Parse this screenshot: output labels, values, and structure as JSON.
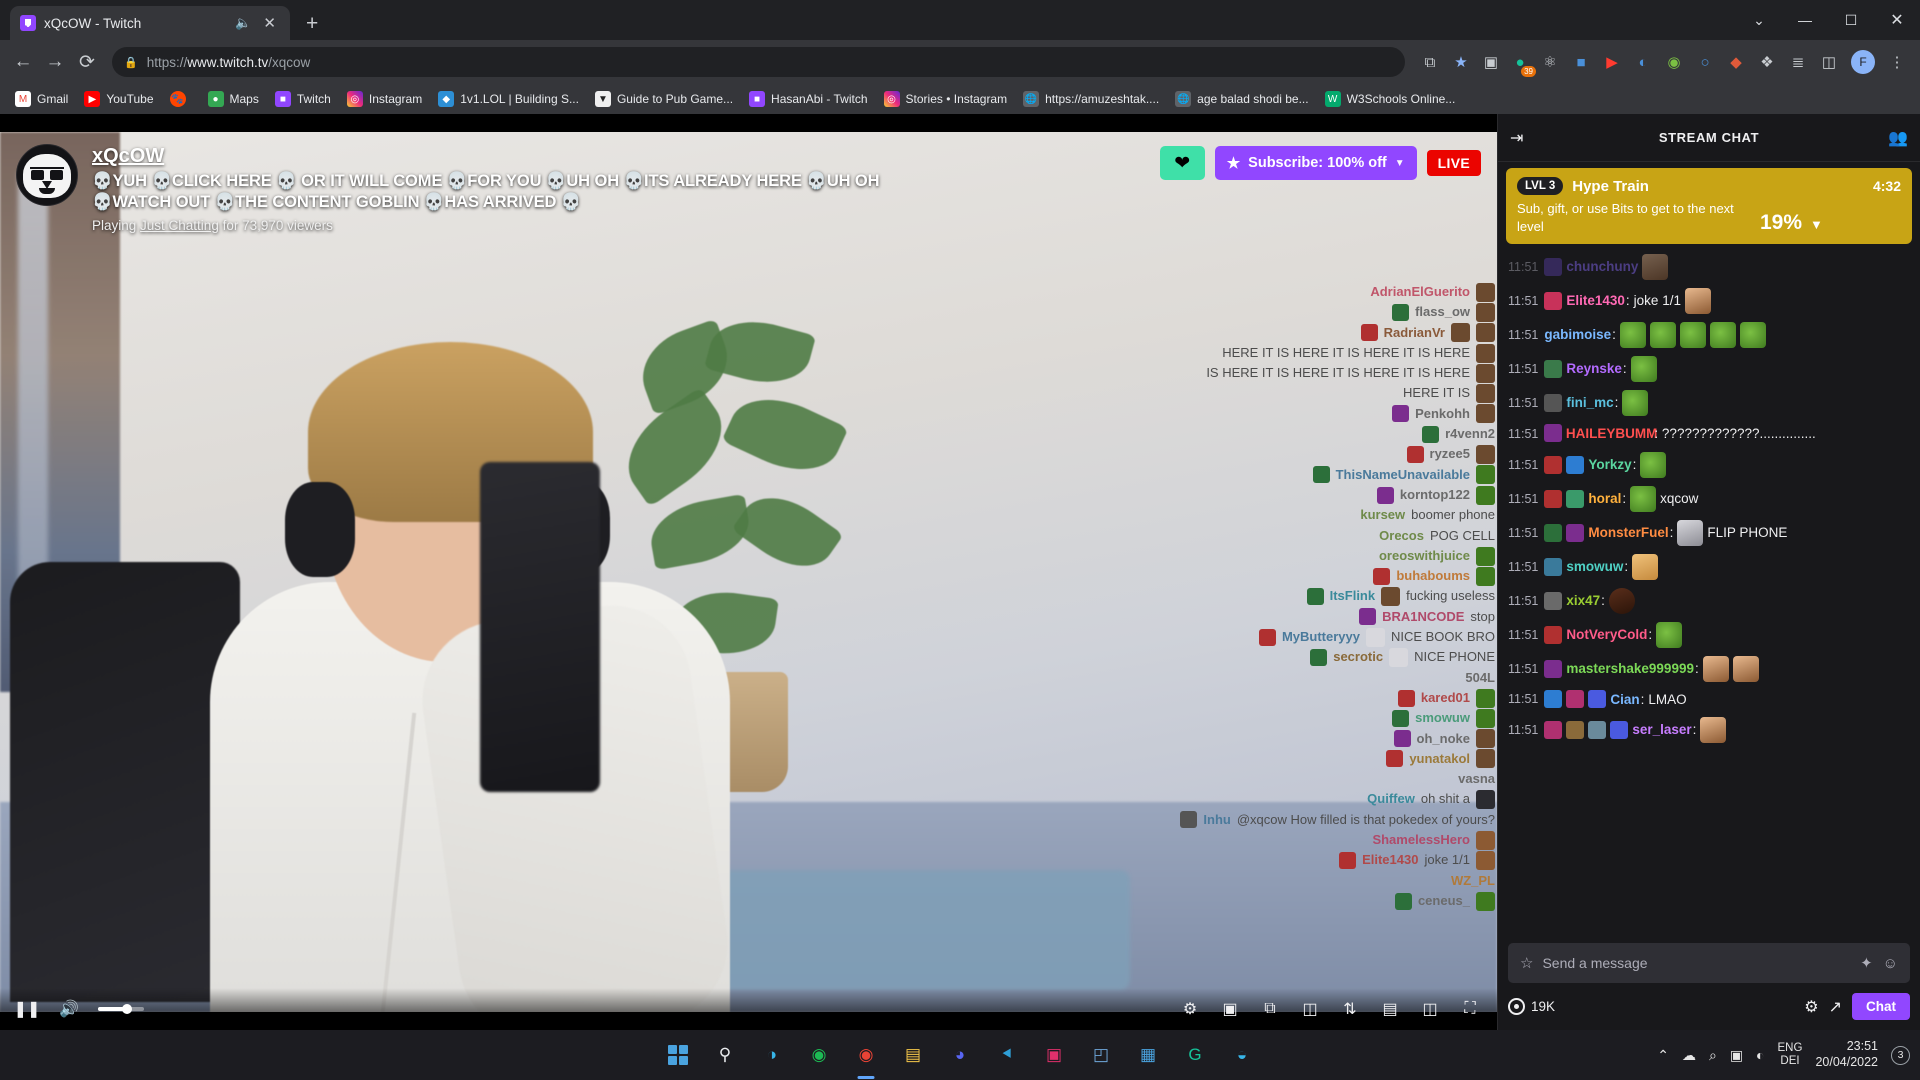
{
  "browser": {
    "tab": {
      "title": "xQcOW - Twitch",
      "favicon": "twitch-icon",
      "audio_icon": "speaker-icon",
      "close_icon": "close-icon"
    },
    "new_tab_icon": "plus-icon",
    "window_controls": {
      "minimize": "─",
      "maximize": "☐",
      "close": "✕",
      "chevron": "⌄"
    },
    "nav": {
      "back_icon": "←",
      "forward_icon": "→",
      "reload_icon": "⟳"
    },
    "omnibox": {
      "lock_icon": "lock-icon",
      "url_scheme": "https://",
      "url_host": "www.twitch.tv",
      "url_path": "/xqcow",
      "share_icon": "share-icon",
      "star_icon": "★"
    },
    "toolbar_extensions": [
      {
        "name": "extension-camera",
        "glyph": "▣",
        "badge": ""
      },
      {
        "name": "extension-grammarly",
        "glyph": "G",
        "badge": "39"
      },
      {
        "name": "extension-shield",
        "glyph": "⛉",
        "badge": ""
      },
      {
        "name": "extension-blue-square",
        "glyph": "■",
        "badge": ""
      },
      {
        "name": "extension-youtube",
        "glyph": "▶",
        "badge": ""
      },
      {
        "name": "extension-volume",
        "glyph": "◐",
        "badge": ""
      },
      {
        "name": "extension-globe",
        "glyph": "◉",
        "badge": ""
      },
      {
        "name": "extension-search",
        "glyph": "○",
        "badge": ""
      },
      {
        "name": "extension-red",
        "glyph": "◆",
        "badge": ""
      },
      {
        "name": "extension-puzzle",
        "glyph": "❖",
        "badge": ""
      },
      {
        "name": "extension-list",
        "glyph": "≣",
        "badge": ""
      },
      {
        "name": "extension-panel",
        "glyph": "◫",
        "badge": ""
      }
    ],
    "profile_initial": "F",
    "menu_icon": "⋮",
    "bookmarks": [
      {
        "label": "Gmail",
        "icon": "gmail-icon",
        "color": "#ea4335"
      },
      {
        "label": "YouTube",
        "icon": "youtube-icon",
        "color": "#ff0000"
      },
      {
        "label": "",
        "icon": "reddit-icon",
        "color": "#ff4500"
      },
      {
        "label": "Maps",
        "icon": "maps-icon",
        "color": "#34a853"
      },
      {
        "label": "Twitch",
        "icon": "twitch-icon",
        "color": "#9146ff"
      },
      {
        "label": "Instagram",
        "icon": "instagram-icon",
        "color": "#e1306c"
      },
      {
        "label": "1v1.LOL | Building S...",
        "icon": "game-icon",
        "color": "#2d8fd5"
      },
      {
        "label": "Guide to Pub Game...",
        "icon": "pub-icon",
        "color": "#efefef"
      },
      {
        "label": "HasanAbi - Twitch",
        "icon": "twitch-icon",
        "color": "#9146ff"
      },
      {
        "label": "Stories • Instagram",
        "icon": "instagram-icon",
        "color": "#e1306c"
      },
      {
        "label": "https://amuzeshtak....",
        "icon": "globe-icon",
        "color": "#5f6368"
      },
      {
        "label": "age balad shodi be...",
        "icon": "globe-icon",
        "color": "#5f6368"
      },
      {
        "label": "W3Schools Online...",
        "icon": "w3schools-icon",
        "color": "#04aa6d"
      }
    ]
  },
  "stream": {
    "channel_name": "xQcOW",
    "title": "💀YUH 💀CLICK HERE 💀 OR IT WILL COME 💀FOR YOU 💀UH OH 💀ITS ALREADY HERE 💀UH OH 💀WATCH OUT 💀THE CONTENT GOBLIN 💀HAS ARRIVED 💀",
    "playing_prefix": "Playing ",
    "category": "Just Chatting",
    "viewers_suffix": " for 73,970 viewers",
    "heart_icon": "heart-icon",
    "subscribe_label": "Subscribe: 100% off",
    "subscribe_star_icon": "star-icon",
    "subscribe_caret_icon": "chevron-down-icon",
    "live_label": "LIVE",
    "controls": {
      "pause_icon": "pause-icon",
      "volume_icon": "volume-icon",
      "settings_icon": "gear-icon",
      "theatre_icon": "theatre-icon",
      "popout_icon": "popout-icon",
      "clips_icon": "clips-icon",
      "share_icon": "share-icon",
      "picture_icon": "picture-in-picture-icon",
      "split_icon": "split-icon",
      "fullscreen_icon": "fullscreen-icon"
    }
  },
  "video_overlay_chat": [
    {
      "user": "AdrianElGuerito",
      "message": "",
      "emotes": 1
    },
    {
      "user": "flass_ow",
      "message": "",
      "emotes": 1
    },
    {
      "user": "RadrianVr",
      "message": "",
      "emotes": 2
    },
    {
      "user": "HERE IT IS HERE IT IS HERE IT IS HERE",
      "message": "",
      "emotes": 4
    },
    {
      "user": "IS HERE IT IS HERE IT IS HERE IT IS HERE",
      "message": "",
      "emotes": 4
    },
    {
      "user": "HERE IT IS",
      "message": "",
      "emotes": 1
    },
    {
      "user": "Penkohh",
      "message": "",
      "emotes": 1
    },
    {
      "user": "r4venn2",
      "message": "",
      "emotes": 0
    },
    {
      "user": "ryzee5",
      "message": "",
      "emotes": 1
    },
    {
      "user": "ThisNameUnavailable",
      "message": "",
      "emotes": 1
    },
    {
      "user": "korntop122",
      "message": "",
      "emotes": 1
    },
    {
      "user": "kursew",
      "message": "boomer phone",
      "emotes": 0
    },
    {
      "user": "Orecos",
      "message": "POG CELL",
      "emotes": 0
    },
    {
      "user": "oreoswithjuice",
      "message": "",
      "emotes": 1
    },
    {
      "user": "buhaboums",
      "message": "",
      "emotes": 1
    },
    {
      "user": "ItsFlink",
      "message": "fucking useless",
      "emotes": 1
    },
    {
      "user": "BRA1NCODE",
      "message": "stop",
      "emotes": 0
    },
    {
      "user": "MyButteryyy",
      "message": "NICE BOOK BRO",
      "emotes": 1
    },
    {
      "user": "secrotic",
      "message": "NICE PHONE",
      "emotes": 1
    },
    {
      "user": "504L",
      "message": "",
      "emotes": 0
    },
    {
      "user": "kared01",
      "message": "",
      "emotes": 1
    },
    {
      "user": "smowuw",
      "message": "",
      "emotes": 1
    },
    {
      "user": "oh_noke",
      "message": "",
      "emotes": 1
    },
    {
      "user": "yunatakol",
      "message": "",
      "emotes": 1
    },
    {
      "user": "vasna",
      "message": "",
      "emotes": 0
    },
    {
      "user": "Quiffew",
      "message": "oh shit a",
      "emotes": 1
    },
    {
      "user": "Inhu",
      "message": "@xqcow How filled is that pokedex of yours?",
      "emotes": 0
    },
    {
      "user": "ShamelessHero",
      "message": "",
      "emotes": 1
    },
    {
      "user": "Elite1430",
      "message": "joke 1/1",
      "emotes": 1
    },
    {
      "user": "WZ_PL",
      "message": "",
      "emotes": 0
    },
    {
      "user": "ceneus_",
      "message": "",
      "emotes": 1
    }
  ],
  "chat": {
    "header_title": "STREAM CHAT",
    "collapse_icon": "collapse-chat-icon",
    "community_icon": "community-icon",
    "hype_train": {
      "level_label": "LVL 3",
      "title": "Hype Train",
      "time": "4:32",
      "description": "Sub, gift, or use Bits to get to the next level",
      "percent": "19%",
      "caret_icon": "chevron-down-icon",
      "color": "#c8a415"
    },
    "messages": [
      {
        "time": "11:51",
        "user": "chunchuny",
        "color": "#8a6aff",
        "badges": 1,
        "text": "",
        "emotes": [
          "face"
        ]
      },
      {
        "time": "11:51",
        "user": "Elite1430",
        "color": "#ff69b4",
        "badges": 1,
        "text": "joke 1/1",
        "emotes": [
          "face"
        ]
      },
      {
        "time": "11:51",
        "user": "gabimoise",
        "color": "#7ab8ff",
        "badges": 0,
        "text": "",
        "emotes": [
          "pepe",
          "pepe",
          "pepe",
          "pepe",
          "pepe"
        ]
      },
      {
        "time": "11:51",
        "user": "Reynske",
        "color": "#b36bff",
        "badges": 1,
        "text": "",
        "emotes": [
          "pepe"
        ]
      },
      {
        "time": "11:51",
        "user": "fini_mc",
        "color": "#5bc0de",
        "badges": 1,
        "text": "",
        "emotes": [
          "pepe"
        ]
      },
      {
        "time": "11:51",
        "user": "HAILEYBUMM",
        "color": "#ff4f4f",
        "badges": 1,
        "text": "?????????????...............",
        "emotes": []
      },
      {
        "time": "11:51",
        "user": "Yorkzy",
        "color": "#5bd6a0",
        "badges": 2,
        "text": "",
        "emotes": [
          "pepe"
        ]
      },
      {
        "time": "11:51",
        "user": "horal",
        "color": "#ffb13d",
        "badges": 2,
        "text": "xqcow",
        "emotes": [
          "pepe"
        ]
      },
      {
        "time": "11:51",
        "user": "MonsterFuel",
        "color": "#ff8c42",
        "badges": 2,
        "text": "FLIP PHONE",
        "emotes": [
          "phone"
        ]
      },
      {
        "time": "11:51",
        "user": "smowuw",
        "color": "#4fd1c5",
        "badges": 1,
        "text": "",
        "emotes": [
          "hand"
        ]
      },
      {
        "time": "11:51",
        "user": "xix47",
        "color": "#9acd32",
        "badges": 1,
        "text": "",
        "emotes": [
          "dark"
        ]
      },
      {
        "time": "11:51",
        "user": "NotVeryCold",
        "color": "#ff5c8a",
        "badges": 1,
        "text": "",
        "emotes": [
          "pepe"
        ]
      },
      {
        "time": "11:51",
        "user": "mastershake999999",
        "color": "#7cd957",
        "badges": 1,
        "text": "",
        "emotes": [
          "face",
          "face"
        ]
      },
      {
        "time": "11:51",
        "user": "Cian",
        "color": "#7ab8ff",
        "badges": 3,
        "text": "LMAO",
        "emotes": []
      },
      {
        "time": "11:51",
        "user": "ser_laser",
        "color": "#c77dff",
        "badges": 4,
        "text": "",
        "emotes": [
          "face"
        ]
      }
    ],
    "input_placeholder": "Send a message",
    "input_left_icon": "badge-icon",
    "input_right_icons": [
      "bits-icon",
      "emote-icon"
    ],
    "viewer_count": "19K",
    "viewer_icon": "viewer-icon",
    "settings_icon": "gear-icon",
    "expand_icon": "expand-icon",
    "chat_button": "Chat"
  },
  "taskbar": {
    "apps": [
      {
        "name": "start-button",
        "glyph": "⊞",
        "color": "#4aa3df"
      },
      {
        "name": "search-taskbar",
        "glyph": "⌕",
        "color": "#e8eaed"
      },
      {
        "name": "edge-app",
        "glyph": "◑",
        "color": "#37b5e8"
      },
      {
        "name": "spotify-app",
        "glyph": "◉",
        "color": "#1db954"
      },
      {
        "name": "chrome-app",
        "glyph": "◉",
        "color": "#ea4335"
      },
      {
        "name": "explorer-app",
        "glyph": "▤",
        "color": "#f7c84a"
      },
      {
        "name": "discord-app",
        "glyph": "◕",
        "color": "#5865f2"
      },
      {
        "name": "vscode-app",
        "glyph": "⯇",
        "color": "#2f9fd7"
      },
      {
        "name": "instagram-app",
        "glyph": "▣",
        "color": "#e1306c"
      },
      {
        "name": "photos-app",
        "glyph": "◰",
        "color": "#6fa8dc"
      },
      {
        "name": "calendar-app",
        "glyph": "▦",
        "color": "#4aa3df"
      },
      {
        "name": "grammarly-app",
        "glyph": "G",
        "color": "#15c39a"
      },
      {
        "name": "edge-beta-app",
        "glyph": "◒",
        "color": "#37b5e8"
      }
    ],
    "tray": {
      "chevron_icon": "⌃",
      "cloud_icon": "☁",
      "mic_icon": "⌕",
      "monitor_icon": "▣",
      "volume_icon": "◐",
      "keyboard_lang": "ENG",
      "keyboard_layout": "DEI",
      "time": "23:51",
      "date": "20/04/2022",
      "notification_count": "3"
    }
  }
}
